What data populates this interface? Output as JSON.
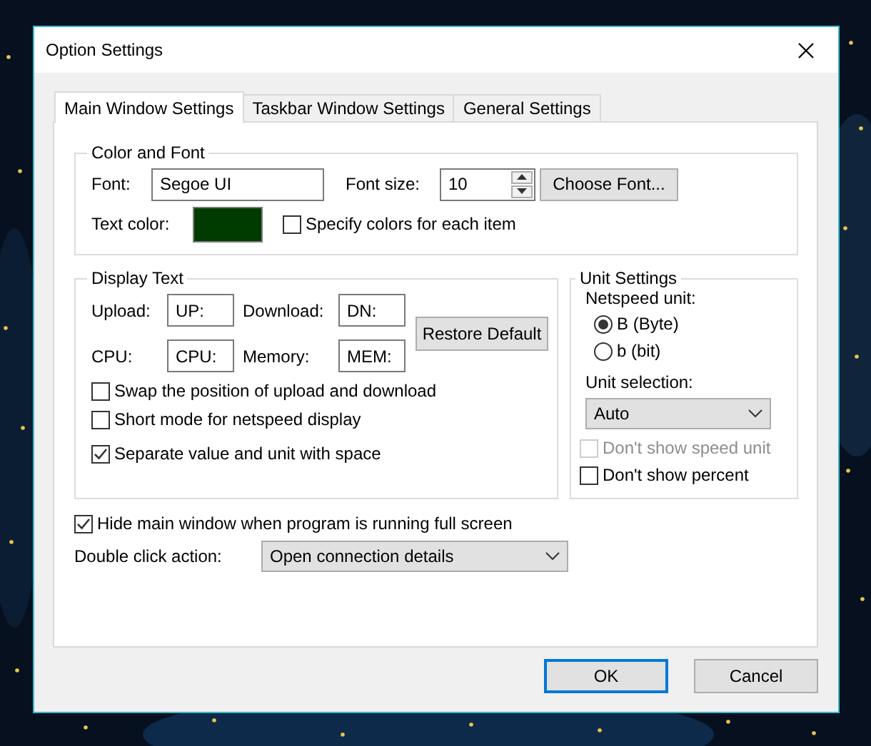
{
  "window": {
    "title": "Option Settings"
  },
  "tabs": [
    {
      "label": "Main Window Settings",
      "selected": true
    },
    {
      "label": "Taskbar Window Settings",
      "selected": false
    },
    {
      "label": "General Settings",
      "selected": false
    }
  ],
  "color_and_font": {
    "title": "Color and Font",
    "font_label": "Font:",
    "font_value": "Segoe UI",
    "font_size_label": "Font size:",
    "font_size_value": "10",
    "choose_font_button": "Choose Font...",
    "text_color_label": "Text color:",
    "text_color_swatch": {
      "color": "#003c00"
    },
    "specify_colors": {
      "label": "Specify colors for each item",
      "checked": false,
      "disabled": false
    }
  },
  "display_text": {
    "title": "Display Text",
    "fields": [
      {
        "label": "Upload:",
        "value": "UP:"
      },
      {
        "label": "Download:",
        "value": "DN:"
      },
      {
        "label": "CPU:",
        "value": "CPU:"
      },
      {
        "label": "Memory:",
        "value": "MEM:"
      }
    ],
    "restore_button": "Restore Default",
    "checkboxes": [
      {
        "label": "Swap the position of upload and download",
        "checked": false,
        "disabled": false
      },
      {
        "label": "Short mode for netspeed display",
        "checked": false,
        "disabled": false
      },
      {
        "label": "Separate value and unit with space",
        "checked": true,
        "disabled": false
      }
    ]
  },
  "unit_settings": {
    "title": "Unit Settings",
    "netspeed_unit_label": "Netspeed unit:",
    "radios": [
      {
        "label": "B (Byte)",
        "selected": true
      },
      {
        "label": "b (bit)",
        "selected": false
      }
    ],
    "unit_selection_label": "Unit selection:",
    "unit_selection_value": "Auto",
    "checkboxes": [
      {
        "label": "Don't show speed unit",
        "checked": false,
        "disabled": true
      },
      {
        "label": "Don't show percent",
        "checked": false,
        "disabled": false
      }
    ]
  },
  "hide_fullscreen": {
    "label": "Hide main window when program is running full screen",
    "checked": true,
    "disabled": false
  },
  "double_click": {
    "label": "Double click action:",
    "value": "Open connection details"
  },
  "buttons": [
    {
      "label": "OK",
      "default": true
    },
    {
      "label": "Cancel",
      "default": false
    }
  ]
}
